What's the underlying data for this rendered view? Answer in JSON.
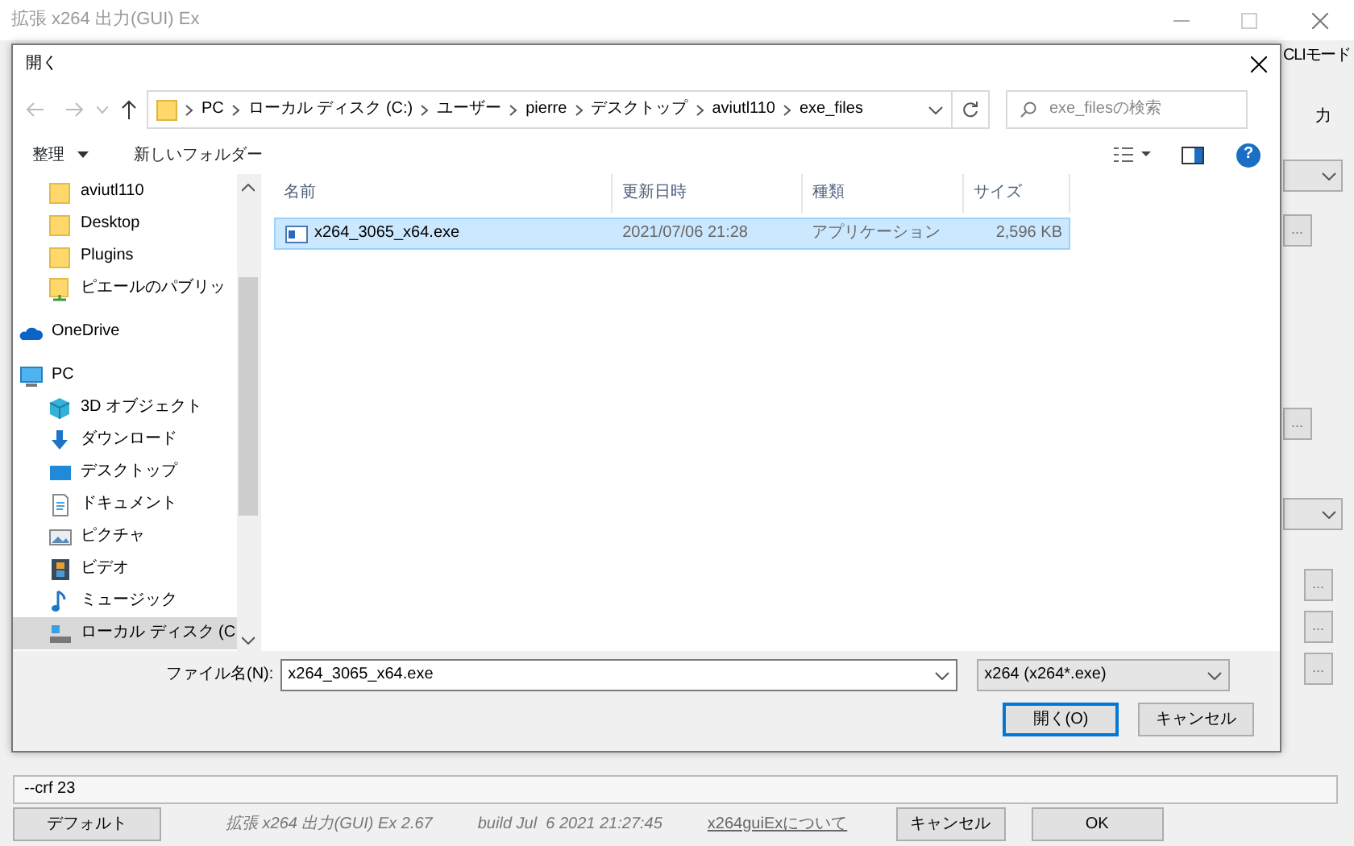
{
  "background_window": {
    "title": "拡張 x264 出力(GUI) Ex",
    "side_controls": [
      {
        "kind": "label",
        "text": "CLIモード"
      },
      {
        "kind": "label",
        "text": "力"
      },
      {
        "kind": "dropdown"
      },
      {
        "kind": "browse",
        "text": "..."
      },
      {
        "kind": "browse",
        "text": "..."
      },
      {
        "kind": "dropdown"
      },
      {
        "kind": "browse",
        "text": "..."
      },
      {
        "kind": "browse",
        "text": "..."
      },
      {
        "kind": "browse",
        "text": "..."
      }
    ],
    "command_line": "--crf 23",
    "footer": {
      "default_button": "デフォルト",
      "version": "拡張 x264 出力(GUI) Ex 2.67",
      "build": "build Jul  6 2021 21:27:45",
      "about_link": "x264guiExについて",
      "cancel_button": "キャンセル",
      "ok_button": "OK"
    }
  },
  "dialog": {
    "title": "開く",
    "breadcrumb": [
      "PC",
      "ローカル ディスク (C:)",
      "ユーザー",
      "pierre",
      "デスクトップ",
      "aviutl110",
      "exe_files"
    ],
    "search": {
      "placeholder": "exe_filesの検索"
    },
    "toolbar": {
      "organize": "整理",
      "new_folder": "新しいフォルダー",
      "help": "?"
    },
    "nav_quick": [
      {
        "label": "aviutl110",
        "kind": "folder",
        "selected": false
      },
      {
        "label": "Desktop",
        "kind": "folder",
        "selected": false
      },
      {
        "label": "Plugins",
        "kind": "folder",
        "selected": false
      },
      {
        "label": "ピエールのパブリッ",
        "kind": "shared",
        "selected": false
      }
    ],
    "nav_roots": [
      {
        "label": "OneDrive",
        "kind": "cloud",
        "selected": false
      },
      {
        "label": "PC",
        "kind": "pc",
        "selected": false,
        "children": [
          {
            "label": "3D オブジェクト",
            "kind": "cube",
            "selected": false
          },
          {
            "label": "ダウンロード",
            "kind": "download",
            "selected": false
          },
          {
            "label": "デスクトップ",
            "kind": "desktop",
            "selected": false
          },
          {
            "label": "ドキュメント",
            "kind": "document",
            "selected": false
          },
          {
            "label": "ピクチャ",
            "kind": "picture",
            "selected": false
          },
          {
            "label": "ビデオ",
            "kind": "video",
            "selected": false
          },
          {
            "label": "ミュージック",
            "kind": "music",
            "selected": false
          },
          {
            "label": "ローカル ディスク (C",
            "kind": "drive",
            "selected": true
          }
        ]
      }
    ],
    "columns": [
      "名前",
      "更新日時",
      "種類",
      "サイズ"
    ],
    "files": [
      {
        "name": "x264_3065_x64.exe",
        "modified": "2021/07/06 21:28",
        "type": "アプリケーション",
        "size": "2,596 KB",
        "selected": true
      }
    ],
    "filename_label": "ファイル名(N):",
    "filename": "x264_3065_x64.exe",
    "filter": "x264 (x264*.exe)",
    "open_button": "開く(O)",
    "cancel_button": "キャンセル"
  }
}
